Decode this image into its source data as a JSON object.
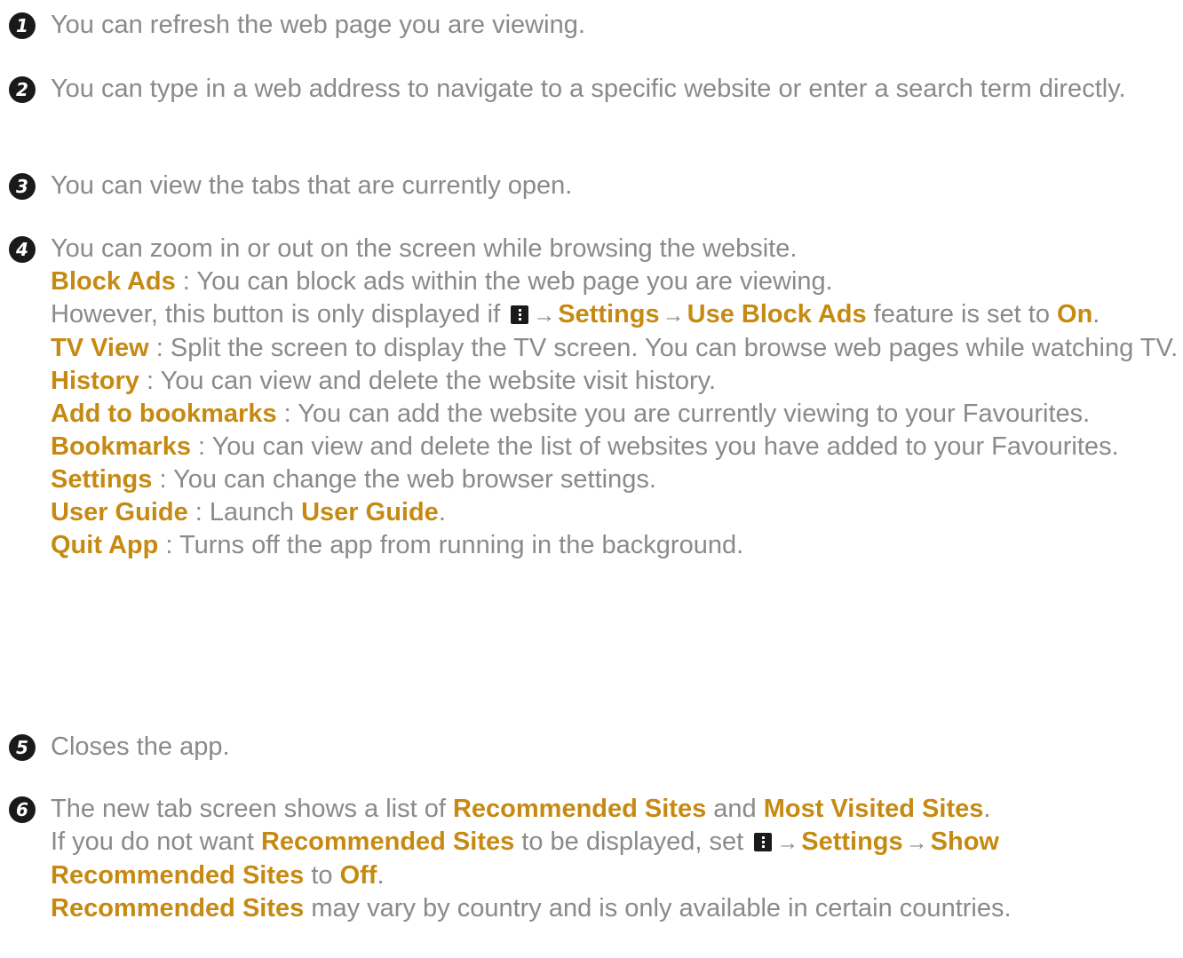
{
  "items": [
    {
      "num": "1",
      "text": "You can refresh the web page you are viewing."
    },
    {
      "num": "2",
      "text": "You can type in a web address to navigate to a specific website or enter a search term directly."
    },
    {
      "num": "3",
      "text": "You can view the tabs that are currently open."
    },
    {
      "num": "4",
      "text": "You can zoom in or out on the screen while browsing the website.",
      "block_ads": {
        "term": "Block Ads",
        "desc": " : You can block ads within the web page you are viewing."
      },
      "block_ads_note": {
        "pre": "However, this button is only displayed if ",
        "arrow": "→",
        "settings": "Settings",
        "use_block_ads": "Use Block Ads",
        "mid": " feature is set to ",
        "on": "On",
        "end": "."
      },
      "tv_view": {
        "term": "TV View",
        "desc": " : Split the screen to display the TV screen. You can browse web pages while watching TV."
      },
      "history": {
        "term": "History",
        "desc": " : You can view and delete the website visit history."
      },
      "add_bookmarks": {
        "term": "Add to bookmarks",
        "desc": " : You can add the website you are currently viewing to your Favourites."
      },
      "bookmarks": {
        "term": "Bookmarks",
        "desc": " : You can view and delete the list of websites you have added to your Favourites."
      },
      "settings": {
        "term": "Settings",
        "desc": " : You can change the web browser settings."
      },
      "user_guide": {
        "term": "User Guide",
        "desc": " : Launch ",
        "term2": "User Guide",
        "end": "."
      },
      "quit_app": {
        "term": "Quit App",
        "desc": " : Turns off the app from running in the background."
      }
    },
    {
      "num": "5",
      "text": "Closes the app."
    },
    {
      "num": "6",
      "line1": {
        "pre": "The new tab screen shows a list of ",
        "rec": "Recommended Sites",
        "and": " and ",
        "most": "Most Visited Sites",
        "end": "."
      },
      "line2": {
        "pre": "If you do not want ",
        "rec": "Recommended Sites",
        "mid": " to be displayed, set ",
        "arrow": "→",
        "settings": "Settings",
        "show": "Show Recommended Sites",
        "to": " to ",
        "off": "Off",
        "end": "."
      },
      "line3": {
        "rec": "Recommended Sites",
        "rest": " may vary by country and is only available in certain countries."
      }
    }
  ],
  "icons": {
    "menu": "more-vert-icon",
    "arrow": "arrow-right-icon"
  },
  "colors": {
    "text": "#8a8a8a",
    "highlight": "#c68a12",
    "bullet": "#1a1a1a"
  }
}
